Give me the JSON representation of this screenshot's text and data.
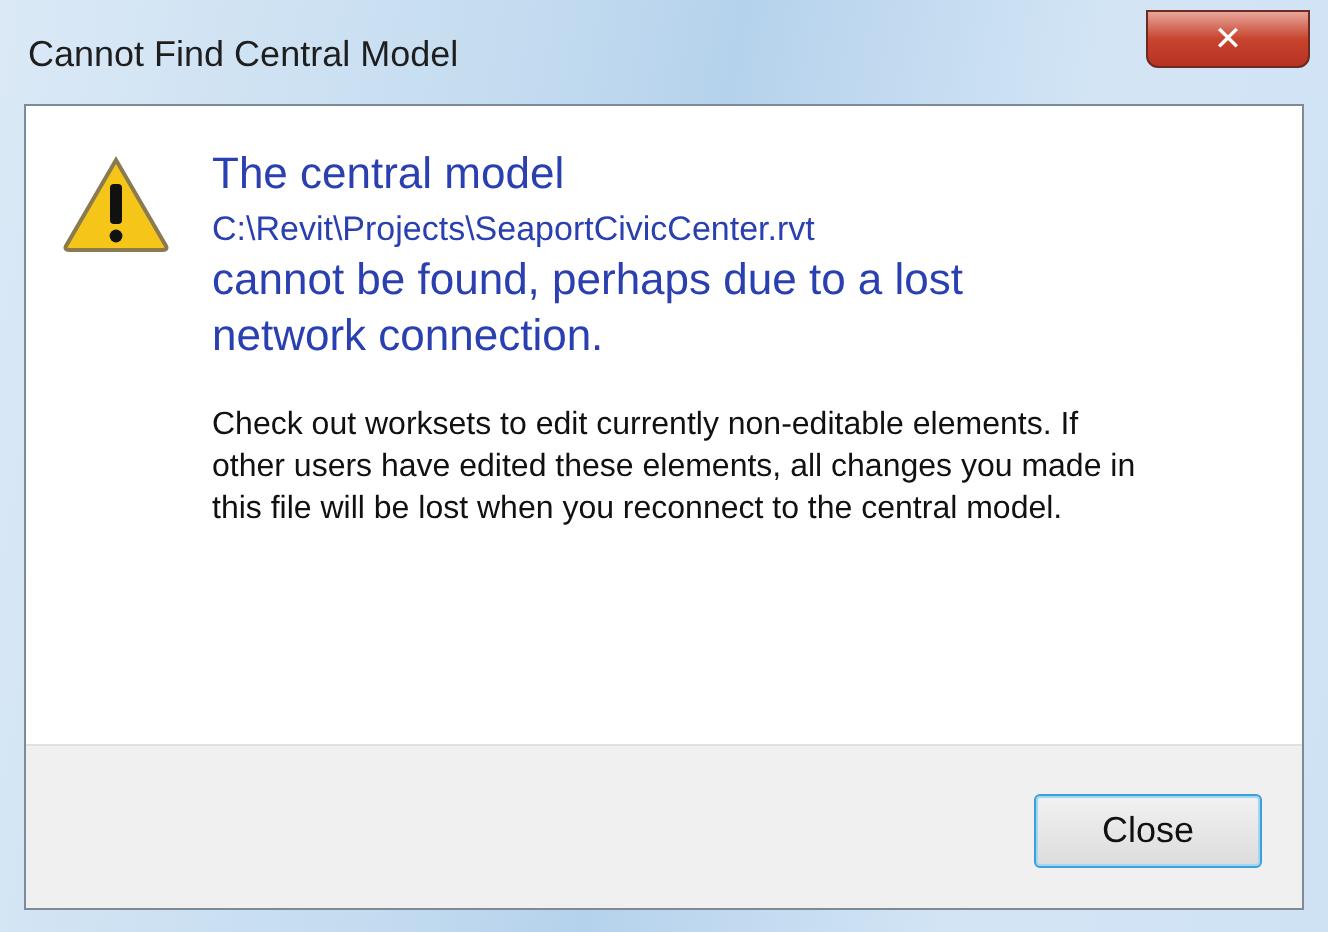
{
  "window": {
    "title": "Cannot Find Central Model",
    "close_glyph": "✕"
  },
  "main_instruction": {
    "lead": "The central model",
    "path": "C:\\Revit\\Projects\\SeaportCivicCenter.rvt",
    "tail": "cannot be found, perhaps due to a lost network connection."
  },
  "content": "Check out worksets to edit currently non-editable elements.  If other users have edited these elements, all changes you made in this file will be lost when you reconnect to the central model.",
  "buttons": [
    {
      "label": "Close",
      "default": true
    }
  ]
}
